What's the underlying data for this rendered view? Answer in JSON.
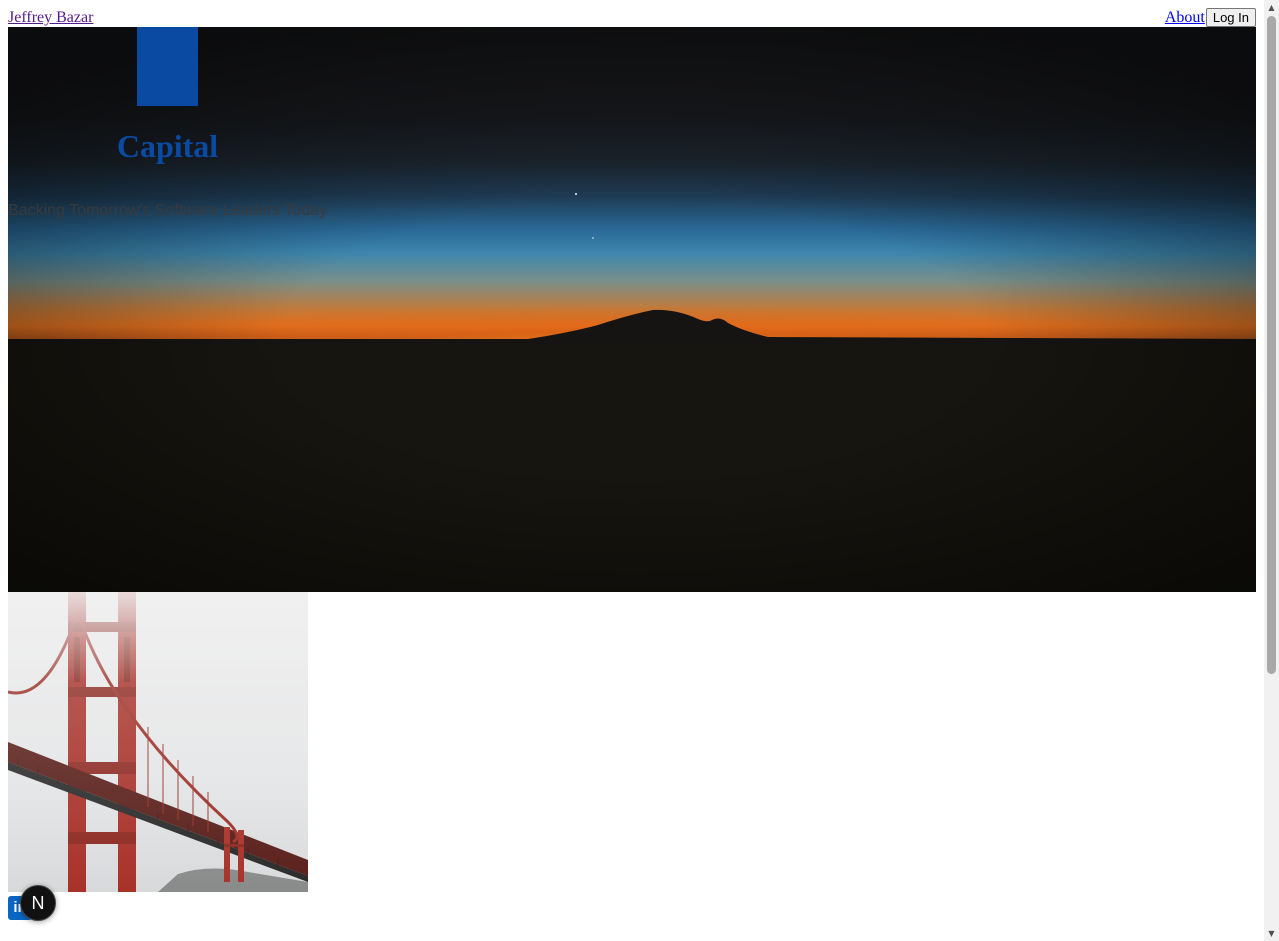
{
  "nav": {
    "brand": "Jeffrey Bazar",
    "about": "About",
    "login": "Log In"
  },
  "hero": {
    "logo_text": "Capital",
    "tagline": "Backing Tomorrow's Software Leaders Today"
  },
  "footer": {
    "linkedin_label": "in",
    "next_badge_label": "N"
  },
  "colors": {
    "brand_blue": "#0a4aa3",
    "linkedin_blue": "#0a66c2"
  },
  "icons": {
    "linkedin": "linkedin-icon",
    "next": "nextjs-icon"
  }
}
